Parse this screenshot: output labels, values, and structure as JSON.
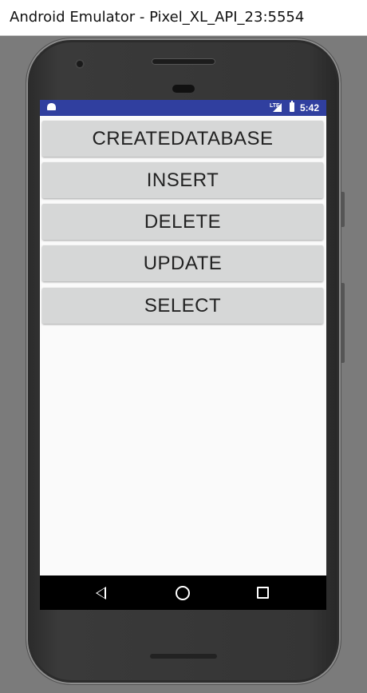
{
  "window": {
    "title": "Android Emulator - Pixel_XL_API_23:5554"
  },
  "status_bar": {
    "time": "5:42",
    "network": "LTE",
    "icons": [
      "android-icon",
      "lte-signal-icon",
      "battery-charging-icon"
    ]
  },
  "buttons": [
    {
      "label": "CREATEDATABASE"
    },
    {
      "label": "INSERT"
    },
    {
      "label": "DELETE"
    },
    {
      "label": "UPDATE"
    },
    {
      "label": "SELECT"
    }
  ],
  "nav_bar": {
    "icons": [
      "back-icon",
      "home-icon",
      "recent-apps-icon"
    ]
  },
  "colors": {
    "status_bar": "#303f9f",
    "button_bg": "#d6d7d7",
    "screen_bg": "#fafafa",
    "nav_bar": "#000000"
  }
}
